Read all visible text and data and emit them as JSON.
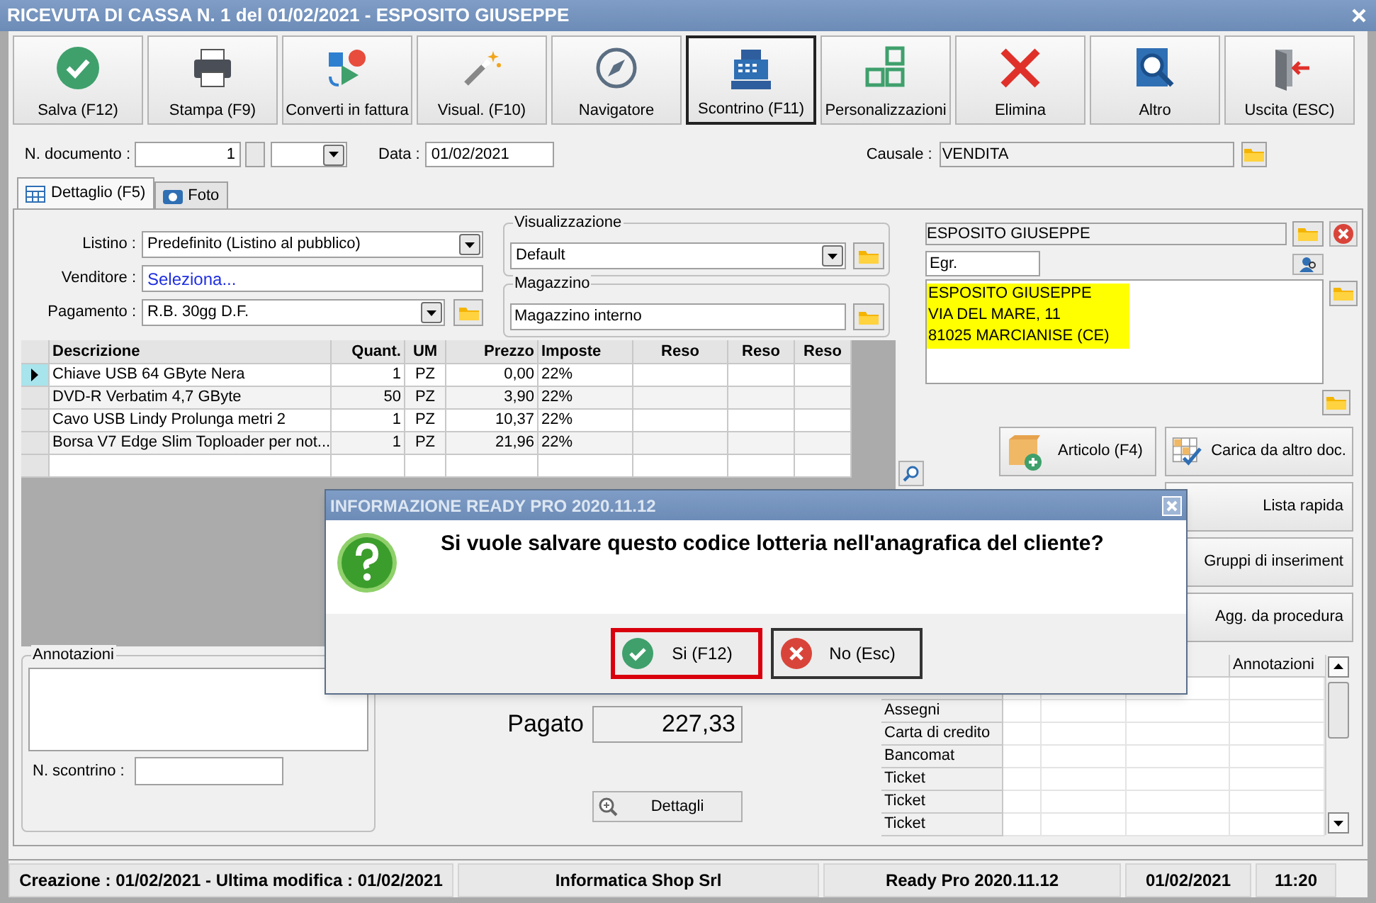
{
  "window": {
    "title": "RICEVUTA DI CASSA N. 1 del 01/02/2021 - ESPOSITO GIUSEPPE"
  },
  "toolbar": [
    {
      "label": "Salva (F12)",
      "kind": "check",
      "selected": false
    },
    {
      "label": "Stampa (F9)",
      "kind": "printer",
      "selected": false
    },
    {
      "label": "Converti in fattura",
      "kind": "convert",
      "selected": false
    },
    {
      "label": "Visual. (F10)",
      "kind": "wand",
      "selected": false
    },
    {
      "label": "Navigatore",
      "kind": "compass",
      "selected": false
    },
    {
      "label": "Scontrino (F11)",
      "kind": "register",
      "selected": true
    },
    {
      "label": "Personalizzazioni",
      "kind": "squares",
      "selected": false
    },
    {
      "label": "Elimina",
      "kind": "cross",
      "selected": false
    },
    {
      "label": "Altro",
      "kind": "search",
      "selected": false
    },
    {
      "label": "Uscita (ESC)",
      "kind": "exit",
      "selected": false
    }
  ],
  "header": {
    "doc_label": "N. documento :",
    "doc_number": "1",
    "date_label": "Data :",
    "date": "01/02/2021",
    "causale_label": "Causale :",
    "causale": "VENDITA"
  },
  "tabs": [
    {
      "label": "Dettaglio (F5)",
      "kind": "table",
      "selected": true
    },
    {
      "label": "Foto",
      "kind": "camera",
      "selected": false
    }
  ],
  "form": {
    "listino_label": "Listino :",
    "listino": "Predefinito (Listino al pubblico)",
    "venditore_label": "Venditore :",
    "venditore_placeholder": "Seleziona...",
    "pagamento_label": "Pagamento :",
    "pagamento": "R.B. 30gg D.F.",
    "visualizzazione_title": "Visualizzazione",
    "visualizzazione": "Default",
    "magazzino_title": "Magazzino",
    "magazzino": "Magazzino interno"
  },
  "items_table": {
    "columns": [
      "Descrizione",
      "Quant.",
      "UM",
      "Prezzo",
      "Imposte",
      "Reso",
      "Reso",
      "Reso"
    ],
    "rows": [
      {
        "cells": [
          "Chiave USB 64 GByte Nera",
          "1",
          "PZ",
          "0,00",
          "22%"
        ],
        "selected": true
      },
      {
        "cells": [
          "DVD-R Verbatim 4,7 GByte",
          "50",
          "PZ",
          "3,90",
          "22%"
        ],
        "selected": false
      },
      {
        "cells": [
          "Cavo USB Lindy Prolunga metri 2",
          "1",
          "PZ",
          "10,37",
          "22%"
        ],
        "selected": false
      },
      {
        "cells": [
          "Borsa V7 Edge Slim Toploader per not...",
          "1",
          "PZ",
          "21,96",
          "22%"
        ],
        "selected": false
      }
    ]
  },
  "customer": {
    "name": "ESPOSITO GIUSEPPE",
    "salutation": "Egr.",
    "address": [
      "ESPOSITO GIUSEPPE",
      "VIA DEL MARE, 11",
      "81025 MARCIANISE (CE)"
    ]
  },
  "actions": [
    {
      "label": "Articolo (F4)",
      "kind": "box"
    },
    {
      "label": "Carica da altro doc.",
      "kind": "gridcheck"
    },
    {
      "label": "Lista rapida",
      "kind": "plain"
    },
    {
      "label": "Gruppi di inseriment",
      "kind": "plain"
    },
    {
      "label": "Agg. da procedura",
      "kind": "plain"
    }
  ],
  "notes": {
    "title": "Annotazioni",
    "receipt_label": "N. scontrino :"
  },
  "totals": {
    "paid_label": "Pagato",
    "paid": "227,33",
    "details_button": "Dettagli"
  },
  "payments": {
    "columns": [
      "Annotazioni"
    ],
    "rows": [
      "Assegni",
      "Carta di credito",
      "Bancomat",
      "Ticket",
      "Ticket",
      "Ticket"
    ]
  },
  "status_bar": [
    "Creazione : 01/02/2021 - Ultima modifica : 01/02/2021",
    "Informatica Shop Srl",
    "Ready Pro 2020.11.12",
    "01/02/2021",
    "11:20"
  ],
  "dialog": {
    "title": "INFORMAZIONE READY PRO 2020.11.12",
    "message": "Si vuole salvare questo codice lotteria nell'anagrafica del cliente?",
    "buttons": [
      {
        "label": "Si (F12)",
        "kind": "yes",
        "selected": true
      },
      {
        "label": "No (Esc)",
        "kind": "no",
        "selected": false
      }
    ]
  }
}
